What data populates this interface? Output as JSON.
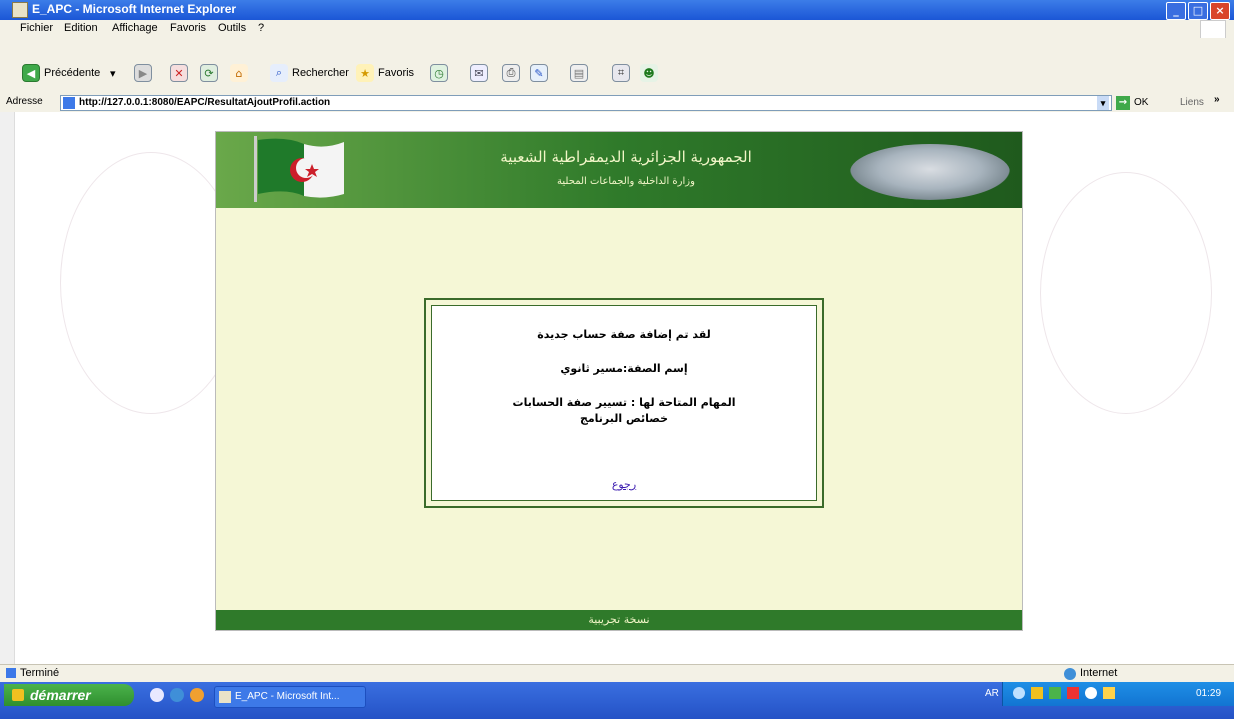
{
  "window": {
    "title": "E_APC - Microsoft Internet Explorer",
    "controls": {
      "minimize": "_",
      "maximize": "□",
      "close": "×"
    }
  },
  "menu": [
    "Fichier",
    "Edition",
    "Affichage",
    "Favoris",
    "Outils",
    "?"
  ],
  "toolbar": {
    "back_label": "Précédente",
    "search_label": "Rechercher",
    "favorites_label": "Favoris"
  },
  "address": {
    "label": "Adresse",
    "url": "http://127.0.0.1:8080/EAPC/ResultatAjoutProfil.action",
    "go_label": "OK",
    "links_label": "Liens"
  },
  "page": {
    "header_title": "الجمهورية الجزائرية الديمقراطية الشعبية",
    "header_subtitle": "وزارة الداخلية والجماعات المحلية",
    "message": {
      "line1": "لقد تم إضافة صفة حساب جديدة",
      "line2": "إسم الصفة:مسير ثانوي",
      "line3": "المهام المتاحة لها : تسيير صفة الحسابات",
      "line4": "خصائص البرنامج",
      "back_link": "رجوع"
    },
    "footer": "نسخة تجريبية"
  },
  "status": {
    "left": "Terminé",
    "zone": "Internet"
  },
  "taskbar": {
    "start_label": "démarrer",
    "task_label": "E_APC - Microsoft Int...",
    "lang": "AR",
    "clock": "01:29"
  },
  "colors": {
    "banner_green": "#2f7a2a",
    "page_background": "#f5f7d6",
    "link": "#3a1ab0"
  },
  "icons": [
    "ie-icon",
    "back-icon",
    "forward-icon",
    "stop-icon",
    "refresh-icon",
    "home-icon",
    "search-icon",
    "favorites-icon",
    "history-icon",
    "mail-icon",
    "print-icon",
    "edit-icon",
    "messenger-icon",
    "go-icon",
    "globe-icon"
  ]
}
